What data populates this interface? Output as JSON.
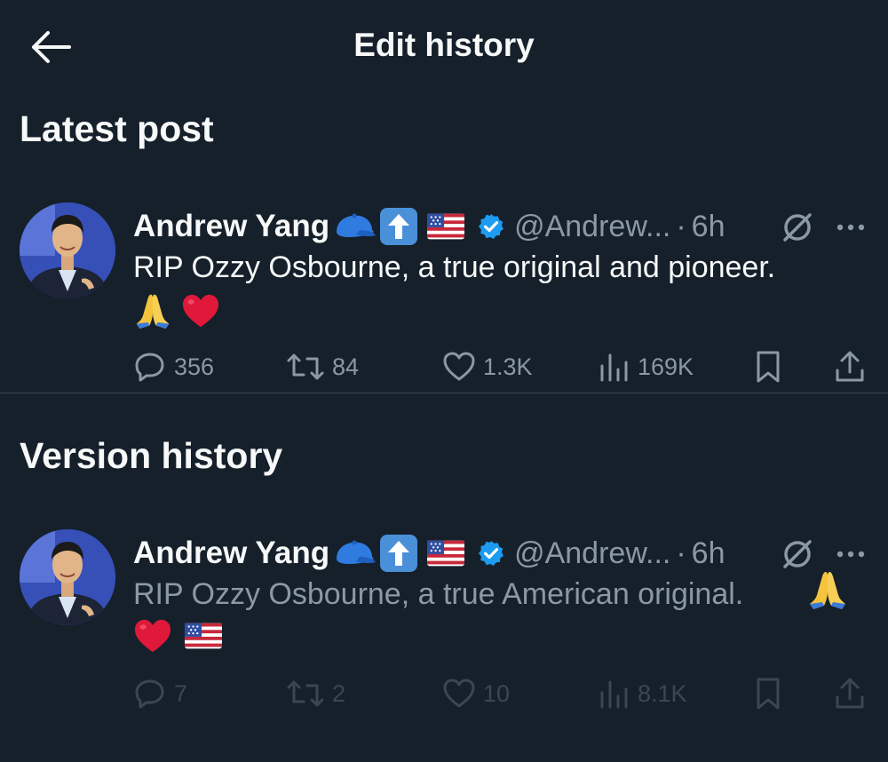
{
  "header": {
    "title": "Edit history"
  },
  "sections": {
    "latest_title": "Latest post",
    "history_title": "Version history"
  },
  "latest": {
    "name": "Andrew Yang",
    "handle": "@Andrew...",
    "separator": "·",
    "time": "6h",
    "text": "RIP Ozzy Osbourne, a true original and pioneer.",
    "emojis": [
      "pray",
      "red-heart"
    ],
    "stats": {
      "replies": "356",
      "reposts": "84",
      "likes": "1.3K",
      "views": "169K"
    }
  },
  "previous": {
    "name": "Andrew Yang",
    "handle": "@Andrew...",
    "separator": "·",
    "time": "6h",
    "text": "RIP Ozzy Osbourne, a true American original.",
    "emojis": [
      "pray",
      "red-heart",
      "us-flag"
    ],
    "stats": {
      "replies": "7",
      "reposts": "2",
      "likes": "10",
      "views": "8.1K"
    }
  },
  "name_badges": [
    "blue-cap",
    "up-arrow-button",
    "us-flag",
    "verified-badge"
  ],
  "colors": {
    "background": "#15202b",
    "text": "#f7f9f9",
    "muted": "#8b98a5",
    "verified": "#1d9bf0",
    "heart": "#e0183a"
  }
}
